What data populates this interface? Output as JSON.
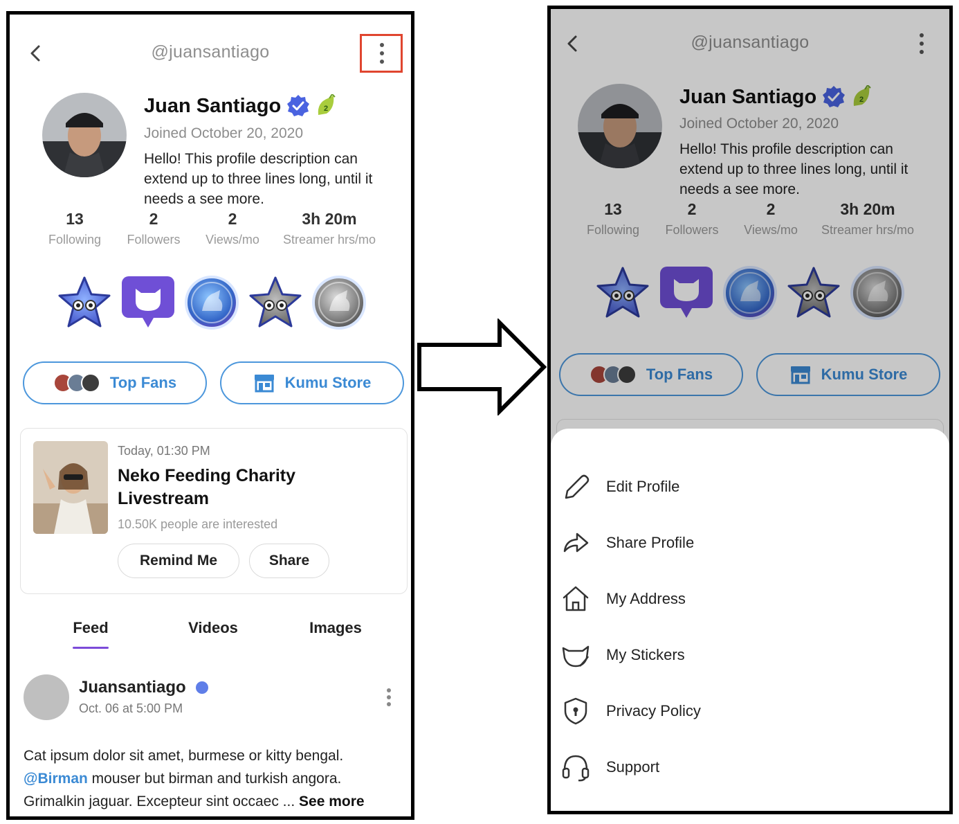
{
  "profile": {
    "handle": "@juansantiago",
    "name": "Juan Santiago",
    "joined": "Joined October 20, 2020",
    "description": "Hello! This profile description can extend up to three lines long, until it needs a see more.",
    "stats": [
      {
        "value": "13",
        "label": "Following"
      },
      {
        "value": "2",
        "label": "Followers"
      },
      {
        "value": "2",
        "label": "Views/mo"
      },
      {
        "value": "3h 20m",
        "label": "Streamer hrs/mo"
      }
    ],
    "badge_level": "2"
  },
  "buttons": {
    "top_fans": "Top Fans",
    "kumu_store": "Kumu Store"
  },
  "event": {
    "time": "Today, 01:30 PM",
    "title": "Neko Feeding Charity Livestream",
    "interested": "10.50K people are interested",
    "remind_label": "Remind Me",
    "share_label": "Share"
  },
  "tabs": [
    "Feed",
    "Videos",
    "Images"
  ],
  "post": {
    "author": "Juansantiago",
    "date": "Oct. 06 at 5:00 PM",
    "text_line1": "Cat ipsum dolor sit amet, burmese or kitty bengal.",
    "mention": "@Birman",
    "text_line2": " mouser but birman and turkish angora.",
    "text_line3": "Grimalkin jaguar. Excepteur sint occaec ... ",
    "see_more": "See more"
  },
  "menu": [
    {
      "label": "Edit Profile",
      "icon": "pencil-icon"
    },
    {
      "label": "Share Profile",
      "icon": "share-arrow-icon"
    },
    {
      "label": "My Address",
      "icon": "home-icon"
    },
    {
      "label": "My Stickers",
      "icon": "cat-sticker-icon"
    },
    {
      "label": "Privacy Policy",
      "icon": "shield-lock-icon"
    },
    {
      "label": "Support",
      "icon": "headset-icon"
    }
  ],
  "colors": {
    "accent_blue": "#3b8ad4",
    "accent_purple": "#7c4bd9",
    "highlight_red": "#e0452f"
  }
}
